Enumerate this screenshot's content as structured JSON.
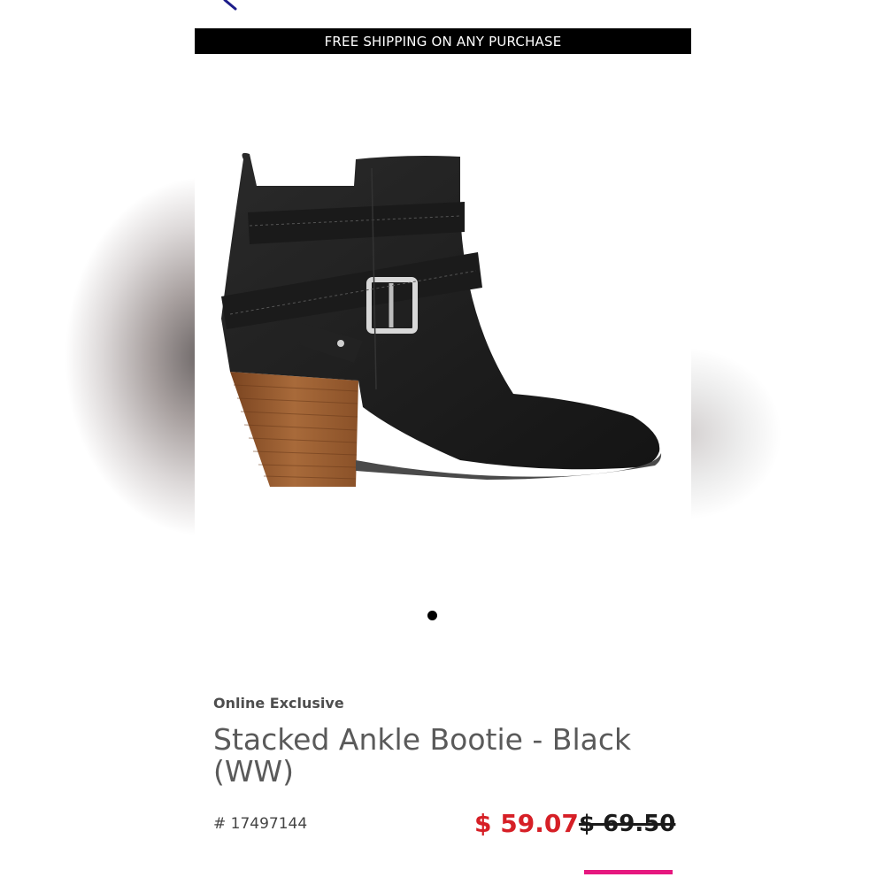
{
  "promo": {
    "text": "FREE SHIPPING ON ANY PURCHASE"
  },
  "product": {
    "image_alt": "Stacked Ankle Bootie - Black (WW)",
    "badge": "Online Exclusive",
    "title": "Stacked Ankle Bootie - Black (WW)",
    "sku": "# 17497144",
    "price_sale": "$ 59.07",
    "price_original": "$ 69.50"
  },
  "carousel": {
    "total": 1,
    "active": 1
  },
  "colors": {
    "sale_price": "#d61f26",
    "accent_pink": "#e6177f",
    "banner_bg": "#000000",
    "back_icon": "#1c1c8a"
  },
  "icons": {
    "back": "back-arrow-icon"
  }
}
